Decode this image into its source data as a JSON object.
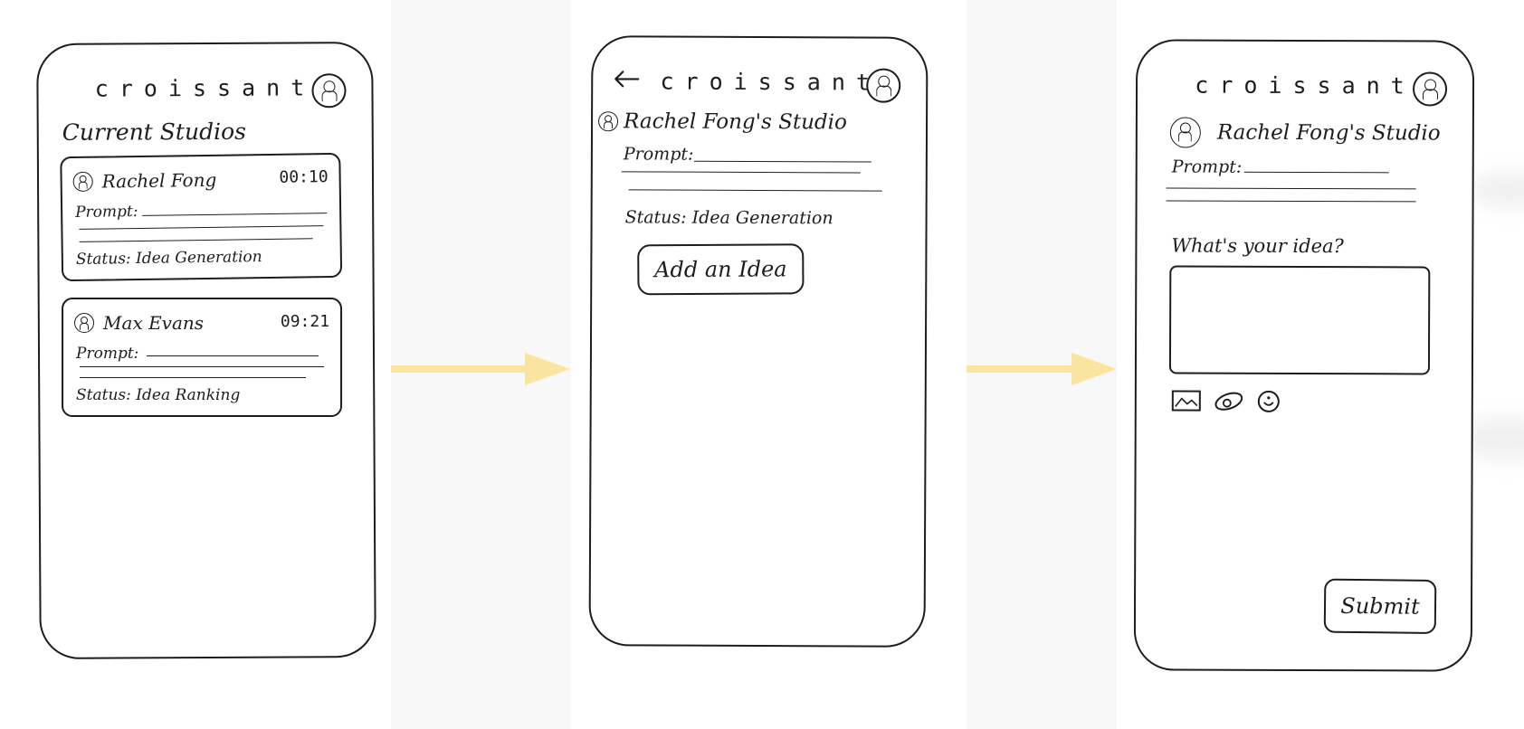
{
  "app": {
    "title": "croissant"
  },
  "screen1": {
    "heading": "Current Studios",
    "studios": [
      {
        "owner": "Rachel Fong",
        "timer": "00:10",
        "prompt_label": "Prompt:",
        "status_text": "Status: Idea Generation"
      },
      {
        "owner": "Max Evans",
        "timer": "09:21",
        "prompt_label": "Prompt:",
        "status_text": "Status: Idea Ranking"
      }
    ]
  },
  "screen2": {
    "back_icon": "left-arrow-icon",
    "studio_title": "Rachel Fong's Studio",
    "prompt_label": "Prompt:",
    "status_text": "Status: Idea Generation",
    "add_idea_label": "Add an Idea"
  },
  "screen3": {
    "studio_title": "Rachel Fong's Studio",
    "prompt_label": "Prompt:",
    "question": "What's your idea?",
    "idea_value": "",
    "attach_icons": [
      "image-icon",
      "drawing-icon",
      "emoji-icon"
    ],
    "submit_label": "Submit"
  },
  "colors": {
    "ink": "#1d1d1d",
    "flow_arrow": "#fbe4a0",
    "paper": "#ffffff",
    "background": "#f8f8f8"
  },
  "flow_arrows": [
    "flow-arrow-icon",
    "flow-arrow-icon"
  ]
}
